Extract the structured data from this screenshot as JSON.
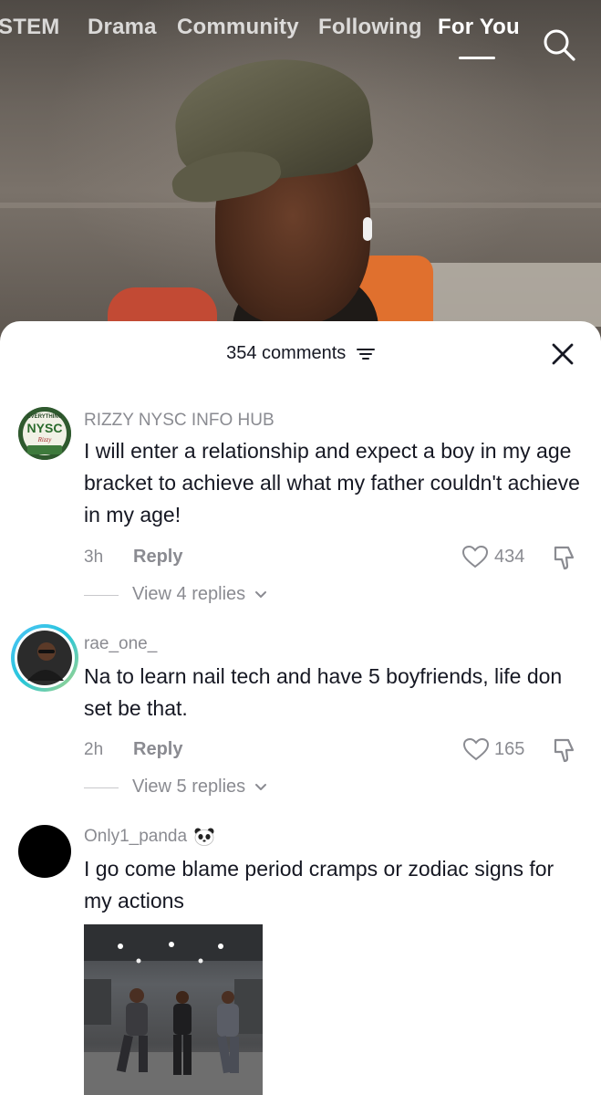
{
  "nav": {
    "tabs": [
      {
        "label": "STEM"
      },
      {
        "label": "Drama"
      },
      {
        "label": "Community"
      },
      {
        "label": "Following"
      },
      {
        "label": "For You",
        "active": true
      }
    ]
  },
  "comments_sheet": {
    "count_label": "354 comments"
  },
  "comments": [
    {
      "username": "RIZZY NYSC INFO HUB",
      "avatar_text": [
        "EVERYTHING",
        "NYSC",
        "Rizzy"
      ],
      "text": "I will enter a relationship and expect a boy in my age bracket to achieve all what my father couldn't achieve in my age!",
      "time": "3h",
      "reply_label": "Reply",
      "likes": "434",
      "view_replies": "View 4 replies"
    },
    {
      "username": "rae_one_",
      "text": "Na to learn nail tech and have 5 boyfriends, life don set be that.",
      "time": "2h",
      "reply_label": "Reply",
      "likes": "165",
      "view_replies": "View 5 replies"
    },
    {
      "username": "Only1_panda",
      "text": "I go come blame period cramps or zodiac signs for my actions"
    }
  ],
  "colors": {
    "text_primary": "#161823",
    "text_secondary": "#8a8b91",
    "sheet_bg": "#ffffff"
  }
}
